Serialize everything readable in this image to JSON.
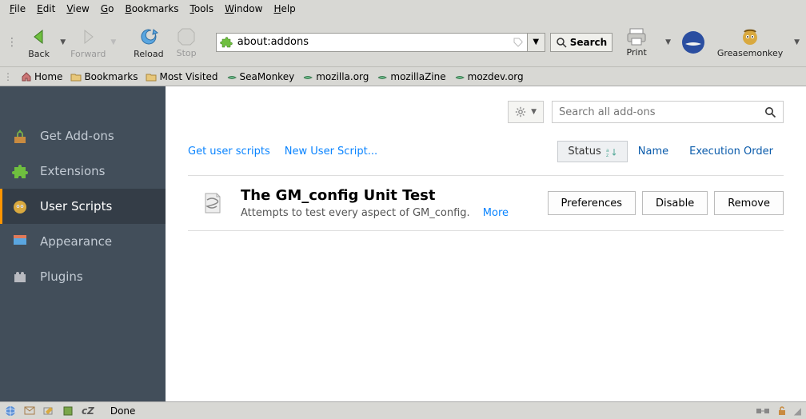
{
  "menu": {
    "file": "File",
    "edit": "Edit",
    "view": "View",
    "go": "Go",
    "bookmarks": "Bookmarks",
    "tools": "Tools",
    "window": "Window",
    "help": "Help"
  },
  "toolbar": {
    "back": "Back",
    "forward": "Forward",
    "reload": "Reload",
    "stop": "Stop",
    "url": "about:addons",
    "search_btn": "Search",
    "print": "Print",
    "gm": "Greasemonkey"
  },
  "bookmarks": {
    "home": "Home",
    "bookmarks": "Bookmarks",
    "most_visited": "Most Visited",
    "seamonkey": "SeaMonkey",
    "mozilla": "mozilla.org",
    "mozillazine": "mozillaZine",
    "mozdev": "mozdev.org"
  },
  "sidebar": {
    "items": [
      {
        "label": "Get Add-ons"
      },
      {
        "label": "Extensions"
      },
      {
        "label": "User Scripts"
      },
      {
        "label": "Appearance"
      },
      {
        "label": "Plugins"
      }
    ]
  },
  "content": {
    "search_placeholder": "Search all add-ons",
    "links": {
      "get": "Get user scripts",
      "new": "New User Script..."
    },
    "sorters": {
      "status": "Status",
      "name": "Name",
      "order": "Execution Order"
    },
    "addon": {
      "title": "The GM_config Unit Test",
      "desc": "Attempts to test every aspect of GM_config.",
      "more": "More",
      "prefs": "Preferences",
      "disable": "Disable",
      "remove": "Remove"
    }
  },
  "status": {
    "done": "Done"
  }
}
